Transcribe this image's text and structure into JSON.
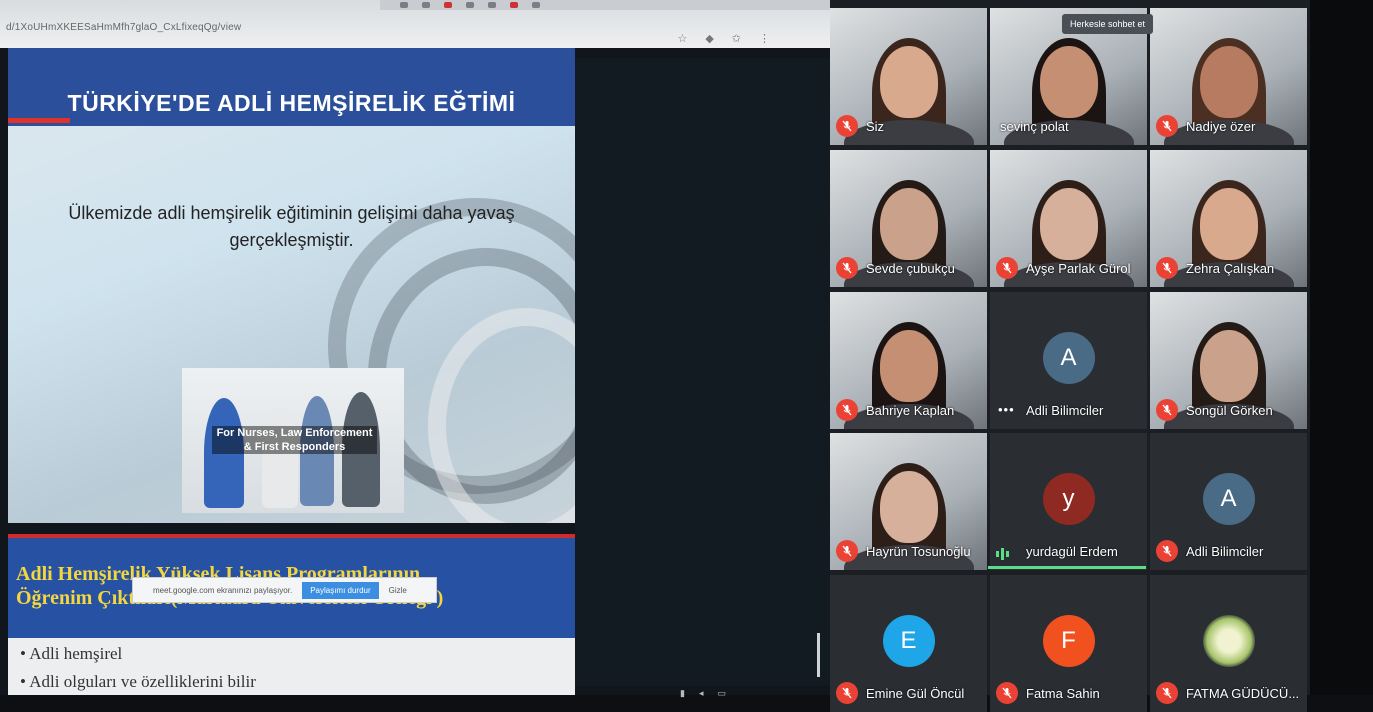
{
  "browser": {
    "url": "d/1XoUHmXKEESaHmMfh7glaO_CxLfixeqQg/view"
  },
  "slide1": {
    "title": "TÜRKİYE'DE ADLİ HEMŞİRELİK EĞTİMİ",
    "body_line1": "Ülkemizde adli hemşirelik eğitiminin gelişimi daha yavaş",
    "body_line2": "gerçekleşmiştir.",
    "photo_caption_line1": "For Nurses, Law Enforcement",
    "photo_caption_line2": "& First Responders"
  },
  "slide2": {
    "title_line1": "Adli Hemşirelik Yüksek Lisans Programlarının",
    "title_line2": "Öğrenim Çıktıları(Marmara Üniversitesi Örneği )",
    "bullet1": "• Adli hemşirel",
    "bullet2": "• Adli olguları ve özelliklerini bilir"
  },
  "share_bar": {
    "text": "meet.google.com ekranınızı paylaşıyor.",
    "stop_button": "Paylaşımı durdur",
    "hide_button": "Gizle"
  },
  "meet": {
    "chat_badge": "Herkesle sohbet et",
    "participants": [
      {
        "name": "Siz",
        "type": "video",
        "muted": true
      },
      {
        "name": "sevinç polat",
        "type": "video",
        "muted": false
      },
      {
        "name": "Nadiye özer",
        "type": "video",
        "muted": true
      },
      {
        "name": "Sevde çubukçu",
        "type": "video",
        "muted": true
      },
      {
        "name": "Ayşe Parlak Gürol",
        "type": "video",
        "muted": true
      },
      {
        "name": "Zehra Çalışkan",
        "type": "video",
        "muted": true
      },
      {
        "name": "Bahriye Kaplan",
        "type": "video",
        "muted": true
      },
      {
        "name": "Adli Bilimciler",
        "type": "avatar",
        "initial": "A",
        "color": "#4a6b86",
        "muted": false
      },
      {
        "name": "Songül Görken",
        "type": "video",
        "muted": true
      },
      {
        "name": "Hayrün Tosunoğlu",
        "type": "video",
        "muted": true
      },
      {
        "name": "yurdagül Erdem",
        "type": "avatar",
        "initial": "y",
        "color": "#8f2a22",
        "muted": false
      },
      {
        "name": "Adli Bilimciler",
        "type": "avatar",
        "initial": "A",
        "color": "#4a6b86",
        "muted": true
      },
      {
        "name": "Emine Gül Öncül",
        "type": "avatar",
        "initial": "E",
        "color": "#1ea6e8",
        "muted": true
      },
      {
        "name": "Fatma Sahin",
        "type": "avatar",
        "initial": "F",
        "color": "#f0511f",
        "muted": true
      },
      {
        "name": "FATMA GÜDÜCÜ...",
        "type": "avatar",
        "initial": "",
        "color": "#2a2e33",
        "muted": true
      }
    ]
  },
  "colors": {
    "slide_header_blue": "#2b4f9a",
    "mute_red": "#ea4335",
    "speaking_green": "#5ddc86",
    "title_yellow": "#f4d63e"
  }
}
